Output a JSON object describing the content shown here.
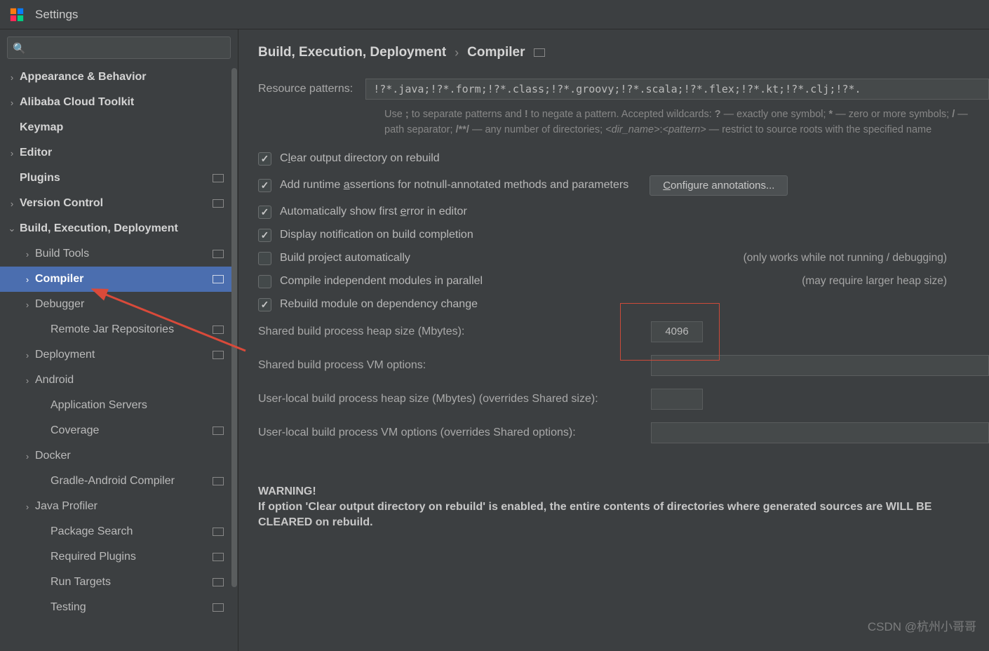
{
  "title": "Settings",
  "search_placeholder": "",
  "sidebar": {
    "items": [
      {
        "label": "Appearance & Behavior",
        "lvl": 1,
        "chev": ">",
        "bold": true
      },
      {
        "label": "Alibaba Cloud Toolkit",
        "lvl": 1,
        "chev": ">",
        "bold": true
      },
      {
        "label": "Keymap",
        "lvl": 1,
        "chev": "",
        "bold": true
      },
      {
        "label": "Editor",
        "lvl": 1,
        "chev": ">",
        "bold": true
      },
      {
        "label": "Plugins",
        "lvl": 1,
        "chev": "",
        "bold": true,
        "badge": true
      },
      {
        "label": "Version Control",
        "lvl": 1,
        "chev": ">",
        "bold": true,
        "badge": true
      },
      {
        "label": "Build, Execution, Deployment",
        "lvl": 1,
        "chev": "v",
        "bold": true
      },
      {
        "label": "Build Tools",
        "lvl": 2,
        "chev": ">",
        "badge": true
      },
      {
        "label": "Compiler",
        "lvl": 2,
        "chev": ">",
        "badge": true,
        "selected": true
      },
      {
        "label": "Debugger",
        "lvl": 2,
        "chev": ">"
      },
      {
        "label": "Remote Jar Repositories",
        "lvl": 2,
        "chev": "",
        "lvl3": true,
        "badge": true
      },
      {
        "label": "Deployment",
        "lvl": 2,
        "chev": ">",
        "badge": true
      },
      {
        "label": "Android",
        "lvl": 2,
        "chev": ">"
      },
      {
        "label": "Application Servers",
        "lvl": 2,
        "chev": "",
        "lvl3": true
      },
      {
        "label": "Coverage",
        "lvl": 2,
        "chev": "",
        "lvl3": true,
        "badge": true
      },
      {
        "label": "Docker",
        "lvl": 2,
        "chev": ">"
      },
      {
        "label": "Gradle-Android Compiler",
        "lvl": 2,
        "chev": "",
        "lvl3": true,
        "badge": true
      },
      {
        "label": "Java Profiler",
        "lvl": 2,
        "chev": ">"
      },
      {
        "label": "Package Search",
        "lvl": 2,
        "chev": "",
        "lvl3": true,
        "badge": true
      },
      {
        "label": "Required Plugins",
        "lvl": 2,
        "chev": "",
        "lvl3": true,
        "badge": true
      },
      {
        "label": "Run Targets",
        "lvl": 2,
        "chev": "",
        "lvl3": true,
        "badge": true
      },
      {
        "label": "Testing",
        "lvl": 2,
        "chev": "",
        "lvl3": true,
        "badge": true
      }
    ]
  },
  "breadcrumb": {
    "parent": "Build, Execution, Deployment",
    "current": "Compiler"
  },
  "resource_patterns": {
    "label": "Resource patterns:",
    "value": "!?*.java;!?*.form;!?*.class;!?*.groovy;!?*.scala;!?*.flex;!?*.kt;!?*.clj;!?*."
  },
  "hint_parts": {
    "p1": "Use ",
    "semi": ";",
    "p2": " to separate patterns and ",
    "bang": "!",
    "p3": " to negate a pattern. Accepted wildcards: ",
    "q": "?",
    "p4": " — exactly one symbol; ",
    "star": "*",
    "p5": " — zero or more symbols; ",
    "slash": "/",
    "p6": " — path separator; ",
    "dstar": "/**/",
    "p7": " — any number of directories;  ",
    "dn": "<dir_name>",
    "p8": ":",
    "pat": "<pattern>",
    "p9": " — restrict to source roots with the specified name"
  },
  "checks": {
    "clear": "Clear output directory on rebuild",
    "assert": "Add runtime assertions for notnull-annotated methods and parameters",
    "autoerr": "Automatically show first error in editor",
    "notif": "Display notification on build completion",
    "autob": "Build project automatically",
    "autob_note": "(only works while not running / debugging)",
    "parallel": "Compile independent modules in parallel",
    "parallel_note": "(may require larger heap size)",
    "rebuild": "Rebuild module on dependency change"
  },
  "config_btn": "Configure annotations...",
  "fields": {
    "heap": {
      "label": "Shared build process heap size (Mbytes):",
      "value": "4096"
    },
    "vm": {
      "label": "Shared build process VM options:",
      "value": ""
    },
    "uheap": {
      "label": "User-local build process heap size (Mbytes) (overrides Shared size):",
      "value": ""
    },
    "uvm": {
      "label": "User-local build process VM options (overrides Shared options):",
      "value": ""
    }
  },
  "warning": {
    "title": "WARNING!",
    "body": "If option 'Clear output directory on rebuild' is enabled, the entire contents of directories where generated sources are WILL BE CLEARED on rebuild."
  },
  "watermark": "CSDN @杭州小哥哥"
}
